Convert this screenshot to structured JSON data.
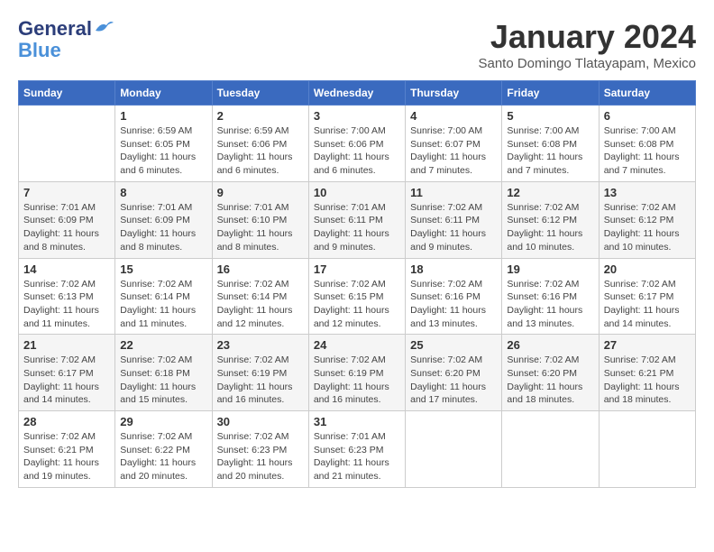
{
  "logo": {
    "line1": "General",
    "line2": "Blue"
  },
  "title": "January 2024",
  "subtitle": "Santo Domingo Tlatayapam, Mexico",
  "weekdays": [
    "Sunday",
    "Monday",
    "Tuesday",
    "Wednesday",
    "Thursday",
    "Friday",
    "Saturday"
  ],
  "weeks": [
    [
      {
        "day": "",
        "info": ""
      },
      {
        "day": "1",
        "info": "Sunrise: 6:59 AM\nSunset: 6:05 PM\nDaylight: 11 hours\nand 6 minutes."
      },
      {
        "day": "2",
        "info": "Sunrise: 6:59 AM\nSunset: 6:06 PM\nDaylight: 11 hours\nand 6 minutes."
      },
      {
        "day": "3",
        "info": "Sunrise: 7:00 AM\nSunset: 6:06 PM\nDaylight: 11 hours\nand 6 minutes."
      },
      {
        "day": "4",
        "info": "Sunrise: 7:00 AM\nSunset: 6:07 PM\nDaylight: 11 hours\nand 7 minutes."
      },
      {
        "day": "5",
        "info": "Sunrise: 7:00 AM\nSunset: 6:08 PM\nDaylight: 11 hours\nand 7 minutes."
      },
      {
        "day": "6",
        "info": "Sunrise: 7:00 AM\nSunset: 6:08 PM\nDaylight: 11 hours\nand 7 minutes."
      }
    ],
    [
      {
        "day": "7",
        "info": "Sunrise: 7:01 AM\nSunset: 6:09 PM\nDaylight: 11 hours\nand 8 minutes."
      },
      {
        "day": "8",
        "info": "Sunrise: 7:01 AM\nSunset: 6:09 PM\nDaylight: 11 hours\nand 8 minutes."
      },
      {
        "day": "9",
        "info": "Sunrise: 7:01 AM\nSunset: 6:10 PM\nDaylight: 11 hours\nand 8 minutes."
      },
      {
        "day": "10",
        "info": "Sunrise: 7:01 AM\nSunset: 6:11 PM\nDaylight: 11 hours\nand 9 minutes."
      },
      {
        "day": "11",
        "info": "Sunrise: 7:02 AM\nSunset: 6:11 PM\nDaylight: 11 hours\nand 9 minutes."
      },
      {
        "day": "12",
        "info": "Sunrise: 7:02 AM\nSunset: 6:12 PM\nDaylight: 11 hours\nand 10 minutes."
      },
      {
        "day": "13",
        "info": "Sunrise: 7:02 AM\nSunset: 6:12 PM\nDaylight: 11 hours\nand 10 minutes."
      }
    ],
    [
      {
        "day": "14",
        "info": "Sunrise: 7:02 AM\nSunset: 6:13 PM\nDaylight: 11 hours\nand 11 minutes."
      },
      {
        "day": "15",
        "info": "Sunrise: 7:02 AM\nSunset: 6:14 PM\nDaylight: 11 hours\nand 11 minutes."
      },
      {
        "day": "16",
        "info": "Sunrise: 7:02 AM\nSunset: 6:14 PM\nDaylight: 11 hours\nand 12 minutes."
      },
      {
        "day": "17",
        "info": "Sunrise: 7:02 AM\nSunset: 6:15 PM\nDaylight: 11 hours\nand 12 minutes."
      },
      {
        "day": "18",
        "info": "Sunrise: 7:02 AM\nSunset: 6:16 PM\nDaylight: 11 hours\nand 13 minutes."
      },
      {
        "day": "19",
        "info": "Sunrise: 7:02 AM\nSunset: 6:16 PM\nDaylight: 11 hours\nand 13 minutes."
      },
      {
        "day": "20",
        "info": "Sunrise: 7:02 AM\nSunset: 6:17 PM\nDaylight: 11 hours\nand 14 minutes."
      }
    ],
    [
      {
        "day": "21",
        "info": "Sunrise: 7:02 AM\nSunset: 6:17 PM\nDaylight: 11 hours\nand 14 minutes."
      },
      {
        "day": "22",
        "info": "Sunrise: 7:02 AM\nSunset: 6:18 PM\nDaylight: 11 hours\nand 15 minutes."
      },
      {
        "day": "23",
        "info": "Sunrise: 7:02 AM\nSunset: 6:19 PM\nDaylight: 11 hours\nand 16 minutes."
      },
      {
        "day": "24",
        "info": "Sunrise: 7:02 AM\nSunset: 6:19 PM\nDaylight: 11 hours\nand 16 minutes."
      },
      {
        "day": "25",
        "info": "Sunrise: 7:02 AM\nSunset: 6:20 PM\nDaylight: 11 hours\nand 17 minutes."
      },
      {
        "day": "26",
        "info": "Sunrise: 7:02 AM\nSunset: 6:20 PM\nDaylight: 11 hours\nand 18 minutes."
      },
      {
        "day": "27",
        "info": "Sunrise: 7:02 AM\nSunset: 6:21 PM\nDaylight: 11 hours\nand 18 minutes."
      }
    ],
    [
      {
        "day": "28",
        "info": "Sunrise: 7:02 AM\nSunset: 6:21 PM\nDaylight: 11 hours\nand 19 minutes."
      },
      {
        "day": "29",
        "info": "Sunrise: 7:02 AM\nSunset: 6:22 PM\nDaylight: 11 hours\nand 20 minutes."
      },
      {
        "day": "30",
        "info": "Sunrise: 7:02 AM\nSunset: 6:23 PM\nDaylight: 11 hours\nand 20 minutes."
      },
      {
        "day": "31",
        "info": "Sunrise: 7:01 AM\nSunset: 6:23 PM\nDaylight: 11 hours\nand 21 minutes."
      },
      {
        "day": "",
        "info": ""
      },
      {
        "day": "",
        "info": ""
      },
      {
        "day": "",
        "info": ""
      }
    ]
  ]
}
